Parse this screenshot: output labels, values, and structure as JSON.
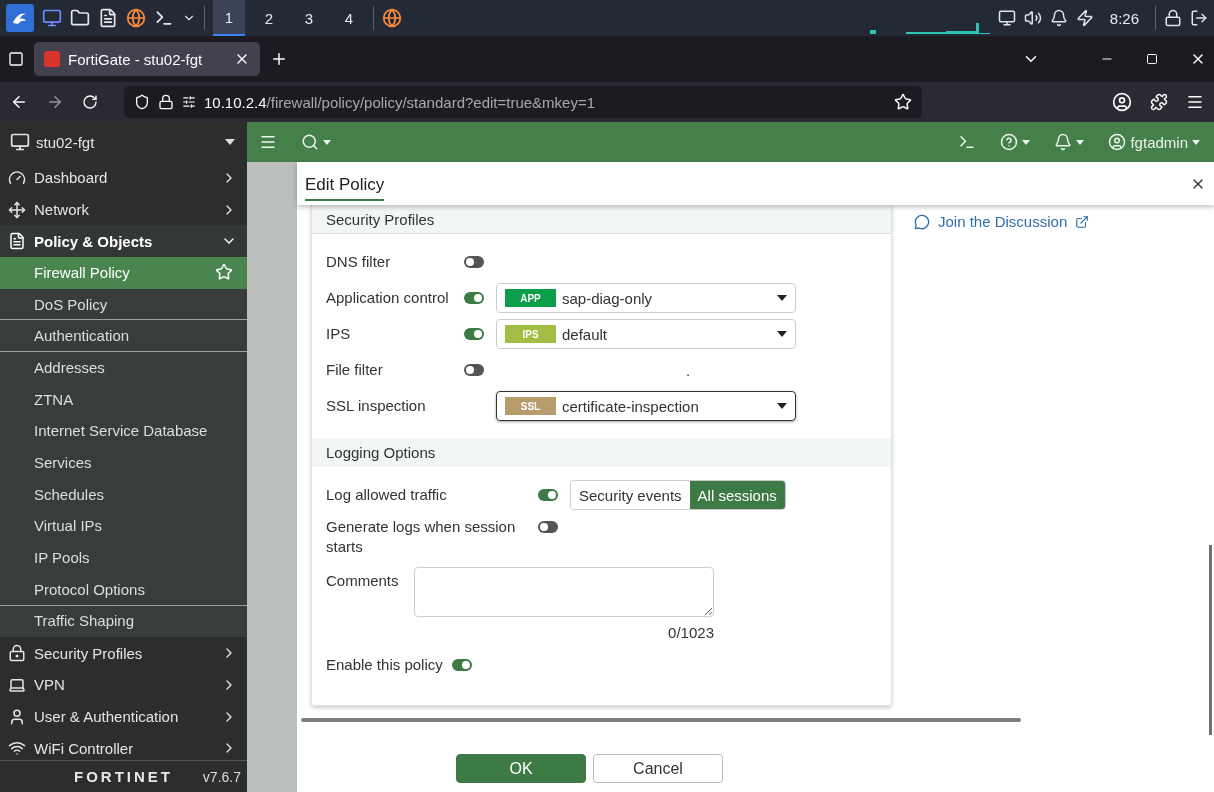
{
  "taskbar": {
    "workspaces": [
      {
        "label": "1",
        "selected": true
      },
      {
        "label": "2",
        "selected": false
      },
      {
        "label": "3",
        "selected": false
      },
      {
        "label": "4",
        "selected": false
      }
    ],
    "clock": "8:26"
  },
  "browser": {
    "tab_title": "FortiGate - stu02-fgt",
    "url_host": "10.10.2.4",
    "url_path": "/firewall/policy/policy/standard?edit=true&mkey=1"
  },
  "sidebar": {
    "device": "stu02-fgt",
    "items": [
      {
        "label": "Dashboard",
        "expanded": false
      },
      {
        "label": "Network",
        "expanded": false
      },
      {
        "label": "Policy & Objects",
        "expanded": true,
        "children": [
          {
            "label": "Firewall Policy",
            "selected": true,
            "divider_after": false
          },
          {
            "label": "DoS Policy",
            "selected": false,
            "divider_after": true
          },
          {
            "label": "Authentication",
            "selected": false,
            "divider_after": true
          },
          {
            "label": "Addresses",
            "selected": false,
            "divider_after": false
          },
          {
            "label": "ZTNA",
            "selected": false,
            "divider_after": false
          },
          {
            "label": "Internet Service Database",
            "selected": false,
            "divider_after": false
          },
          {
            "label": "Services",
            "selected": false,
            "divider_after": false
          },
          {
            "label": "Schedules",
            "selected": false,
            "divider_after": false
          },
          {
            "label": "Virtual IPs",
            "selected": false,
            "divider_after": false
          },
          {
            "label": "IP Pools",
            "selected": false,
            "divider_after": false
          },
          {
            "label": "Protocol Options",
            "selected": false,
            "divider_after": true
          },
          {
            "label": "Traffic Shaping",
            "selected": false,
            "divider_after": false
          }
        ]
      },
      {
        "label": "Security Profiles",
        "expanded": false
      },
      {
        "label": "VPN",
        "expanded": false
      },
      {
        "label": "User & Authentication",
        "expanded": false
      },
      {
        "label": "WiFi Controller",
        "expanded": false
      }
    ],
    "logo": "FORTINET",
    "version": "v7.6.7"
  },
  "topbar": {
    "user": "fgtadmin"
  },
  "modal": {
    "title": "Edit Policy",
    "sections": [
      {
        "title": "Security Profiles",
        "rows": [
          {
            "kind": "profile",
            "label": "DNS filter",
            "on": false
          },
          {
            "kind": "profile",
            "label": "Application control",
            "on": true,
            "profile": {
              "tag": "APP",
              "color": "#0a9e4a",
              "value": "sap-diag-only",
              "focused": false
            }
          },
          {
            "kind": "profile",
            "label": "IPS",
            "on": true,
            "profile": {
              "tag": "IPS",
              "color": "#a4bd45",
              "value": "default",
              "focused": false
            }
          },
          {
            "kind": "profile",
            "label": "File filter",
            "on": false,
            "note": "."
          },
          {
            "kind": "select",
            "label": "SSL inspection",
            "profile": {
              "tag": "SSL",
              "color": "#b99c6b",
              "value": "certificate-inspection",
              "focused": true
            }
          }
        ]
      },
      {
        "title": "Logging Options",
        "rows": [
          {
            "kind": "segmented",
            "label": "Log allowed traffic",
            "on": true,
            "options": [
              {
                "label": "Security events",
                "selected": false
              },
              {
                "label": "All sessions",
                "selected": true
              }
            ]
          },
          {
            "kind": "toggle",
            "label": "Generate logs when session starts",
            "on": false
          },
          {
            "kind": "textarea",
            "label": "Comments",
            "counter": "0/1023"
          },
          {
            "kind": "toggle",
            "label": "Enable this policy",
            "on": true
          }
        ]
      }
    ],
    "link": "Join the Discussion",
    "buttons": [
      {
        "label": "OK",
        "kind": "primary"
      },
      {
        "label": "Cancel",
        "kind": "secondary"
      }
    ]
  }
}
